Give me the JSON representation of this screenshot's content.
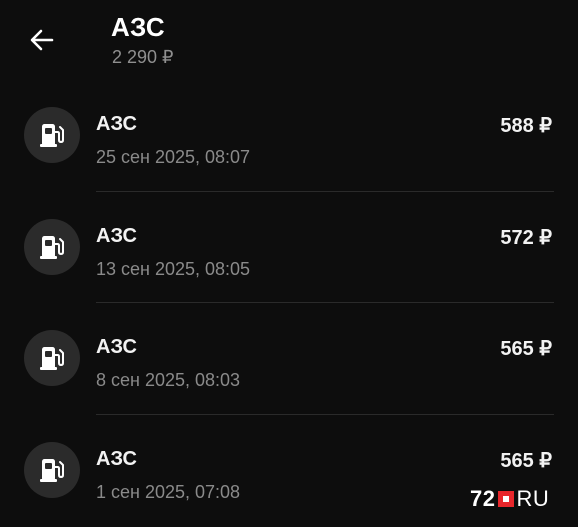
{
  "header": {
    "title": "АЗС",
    "total": "2 290 ₽",
    "back_icon": "arrow-left-icon"
  },
  "transactions": [
    {
      "title": "АЗС",
      "date": "25 сен 2025, 08:07",
      "amount": "588 ₽",
      "icon": "fuel-pump-icon"
    },
    {
      "title": "АЗС",
      "date": "13 сен 2025, 08:05",
      "amount": "572 ₽",
      "icon": "fuel-pump-icon"
    },
    {
      "title": "АЗС",
      "date": "8 сен 2025, 08:03",
      "amount": "565 ₽",
      "icon": "fuel-pump-icon"
    },
    {
      "title": "АЗС",
      "date": "1 сен 2025, 07:08",
      "amount": "565 ₽",
      "icon": "fuel-pump-icon"
    }
  ],
  "watermark": {
    "number": "72",
    "tld": "RU"
  },
  "colors": {
    "background": "#0d0d0d",
    "avatar": "#2b2b2b",
    "secondary_text": "#8a8a8a",
    "brand_red": "#e8262b"
  }
}
